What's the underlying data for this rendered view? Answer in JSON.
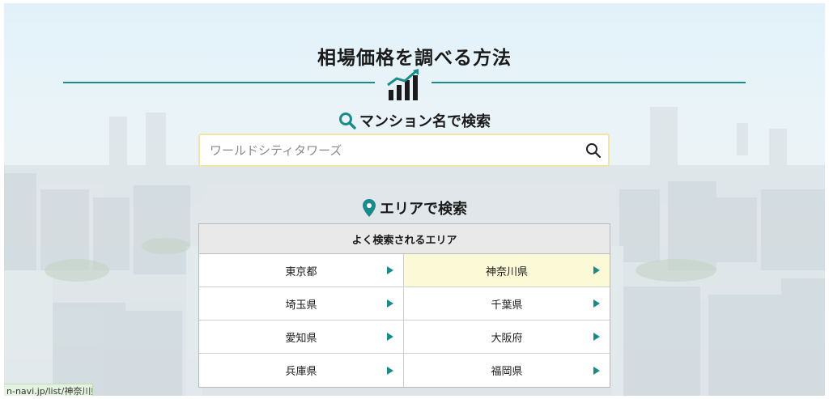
{
  "page": {
    "title": "相場価格を調べる方法"
  },
  "search_section": {
    "title": "マンション名で検索",
    "placeholder": "ワールドシティタワーズ"
  },
  "area_section": {
    "title": "エリアで検索",
    "panel_header": "よく検索されるエリア",
    "areas": [
      {
        "label": "東京都",
        "selected": false
      },
      {
        "label": "神奈川県",
        "selected": true
      },
      {
        "label": "埼玉県",
        "selected": false
      },
      {
        "label": "千葉県",
        "selected": false
      },
      {
        "label": "愛知県",
        "selected": false
      },
      {
        "label": "大阪府",
        "selected": false
      },
      {
        "label": "兵庫県",
        "selected": false
      },
      {
        "label": "福岡県",
        "selected": false
      }
    ]
  },
  "status_bar": {
    "url": "n-navi.jp/list/神奈川県"
  },
  "colors": {
    "accent": "#1a8a8a",
    "selected_cell": "#fbf9d6",
    "search_border": "#f0e6a8"
  },
  "icons": {
    "title_icon": "chart-growth-icon",
    "search_section_icon": "magnifier-icon",
    "area_section_icon": "map-pin-icon",
    "search_button_icon": "search-icon",
    "cell_arrow_icon": "triangle-right-icon"
  }
}
